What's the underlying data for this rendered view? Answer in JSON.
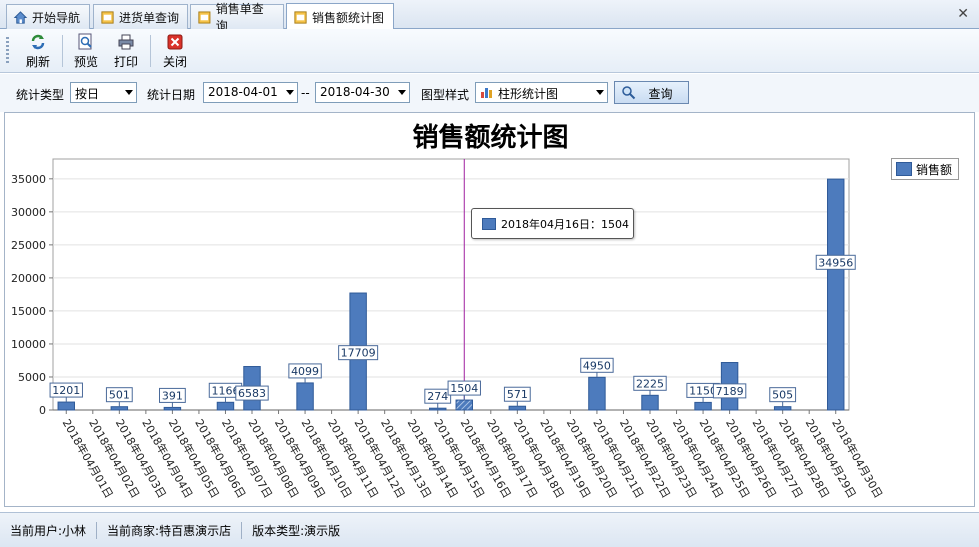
{
  "tabs": [
    {
      "label": "开始导航",
      "icon": "home-icon"
    },
    {
      "label": "进货单查询",
      "icon": "document-icon"
    },
    {
      "label": "销售单查询",
      "icon": "document-icon"
    },
    {
      "label": "销售额统计图",
      "icon": "document-icon"
    }
  ],
  "toolbar": {
    "refresh": "刷新",
    "preview": "预览",
    "print": "打印",
    "close": "关闭"
  },
  "filters": {
    "stat_type_label": "统计类型",
    "stat_type_value": "按日",
    "date_label": "统计日期",
    "date_from": "2018-04-01",
    "date_sep": "--",
    "date_to": "2018-04-30",
    "style_label": "图型样式",
    "style_value": "柱形统计图",
    "query_button": "查询"
  },
  "tooltip": {
    "text": "2018年04月16日：1504"
  },
  "status": {
    "user": "当前用户:小林",
    "merchant": "当前商家:特百惠演示店",
    "version": "版本类型:演示版"
  },
  "colors": {
    "bar": "#4d7bbd",
    "bar_border": "#2f5a98",
    "crosshair": "#a020a0"
  },
  "chart_data": {
    "type": "bar",
    "title": "销售额统计图",
    "legend": "销售额",
    "legend_position": "top-right",
    "ylim": [
      0,
      38000
    ],
    "yticks": [
      0,
      5000,
      10000,
      15000,
      20000,
      25000,
      30000,
      35000
    ],
    "grid": true,
    "highlighted_index": 15,
    "categories": [
      "2018年04月01日",
      "2018年04月02日",
      "2018年04月03日",
      "2018年04月04日",
      "2018年04月05日",
      "2018年04月06日",
      "2018年04月07日",
      "2018年04月08日",
      "2018年04月09日",
      "2018年04月10日",
      "2018年04月11日",
      "2018年04月12日",
      "2018年04月13日",
      "2018年04月14日",
      "2018年04月15日",
      "2018年04月16日",
      "2018年04月17日",
      "2018年04月18日",
      "2018年04月19日",
      "2018年04月20日",
      "2018年04月21日",
      "2018年04月22日",
      "2018年04月23日",
      "2018年04月24日",
      "2018年04月25日",
      "2018年04月26日",
      "2018年04月27日",
      "2018年04月28日",
      "2018年04月29日",
      "2018年04月30日"
    ],
    "series": [
      {
        "name": "销售额",
        "values": [
          1201,
          501,
          391,
          1166,
          6583,
          4099,
          17709,
          274,
          1504,
          571,
          4950,
          2225,
          1150,
          7189,
          505,
          34956
        ]
      }
    ],
    "bar_positions": [
      1,
      3,
      5,
      7,
      8,
      10,
      12,
      15,
      16,
      18,
      21,
      23,
      25,
      26,
      28,
      30
    ]
  }
}
